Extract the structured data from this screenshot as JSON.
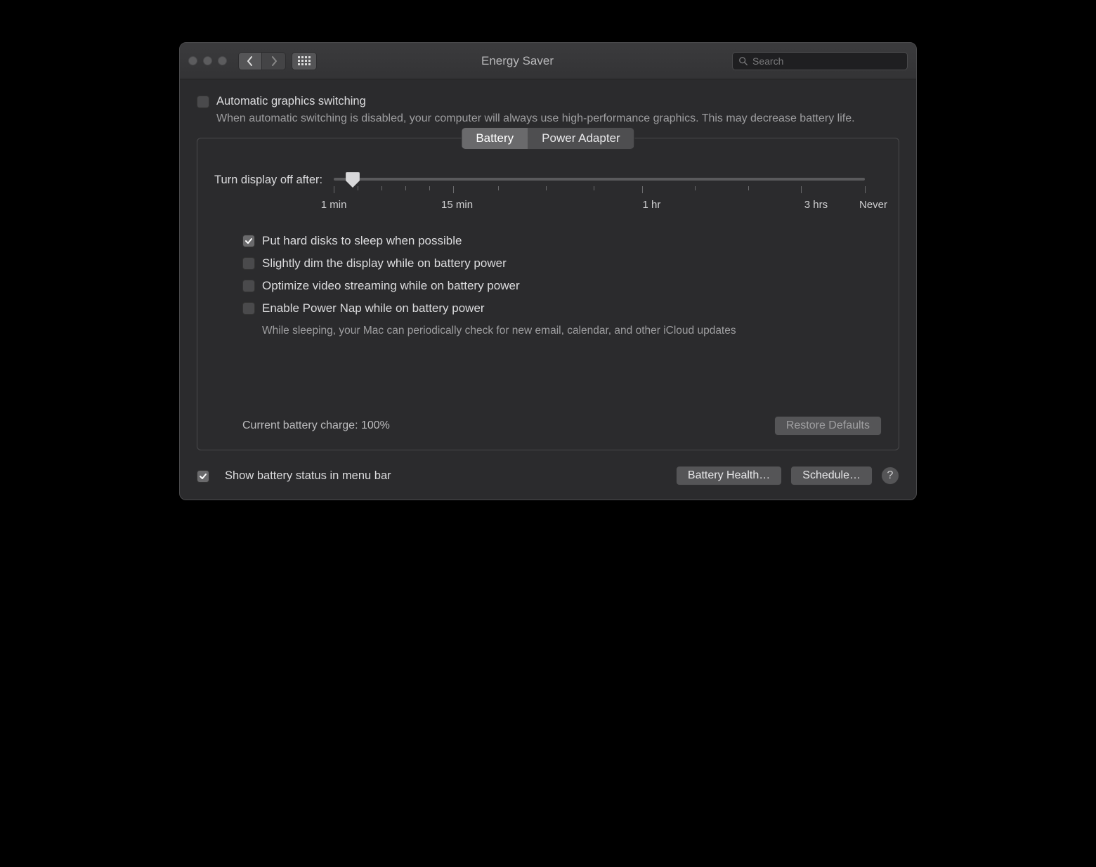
{
  "window": {
    "title": "Energy Saver"
  },
  "search": {
    "placeholder": "Search"
  },
  "auto_graphics": {
    "label": "Automatic graphics switching",
    "description": "When automatic switching is disabled, your computer will always use high-performance graphics. This may decrease battery life."
  },
  "tabs": {
    "battery": "Battery",
    "power_adapter": "Power Adapter"
  },
  "slider": {
    "label": "Turn display off after:",
    "ticks": {
      "t0": "1 min",
      "t1": "15 min",
      "t2": "1 hr",
      "t3": "3 hrs",
      "t4": "Never"
    }
  },
  "options": {
    "hdd_sleep": "Put hard disks to sleep when possible",
    "dim_display": "Slightly dim the display while on battery power",
    "optimize_video": "Optimize video streaming while on battery power",
    "power_nap": "Enable Power Nap while on battery power",
    "power_nap_desc": "While sleeping, your Mac can periodically check for new email, calendar, and other iCloud updates"
  },
  "status": {
    "charge": "Current battery charge: 100%"
  },
  "buttons": {
    "restore": "Restore Defaults",
    "battery_health": "Battery Health…",
    "schedule": "Schedule…"
  },
  "footer": {
    "show_status": "Show battery status in menu bar"
  }
}
